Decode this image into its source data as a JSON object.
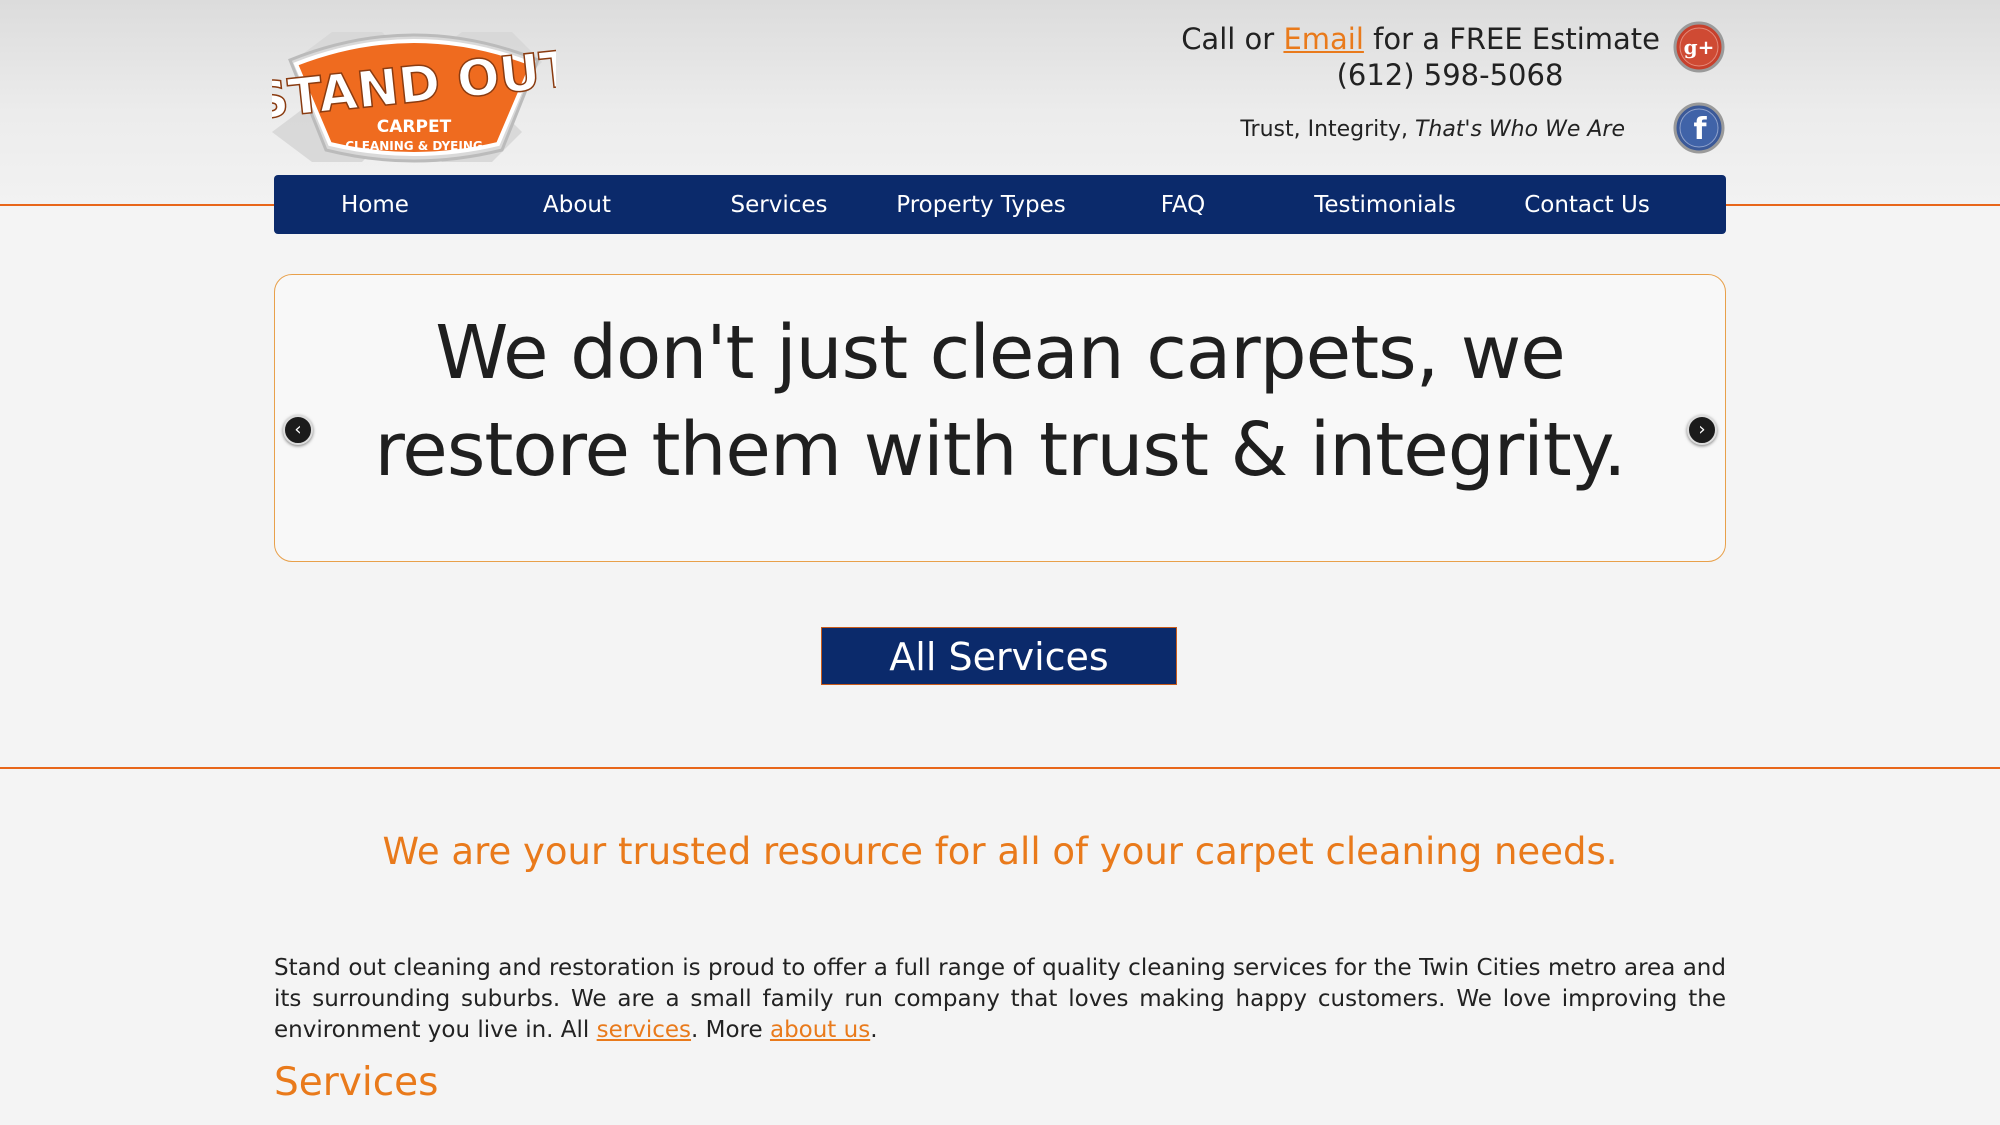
{
  "brand": {
    "logo_line1": "STAND OUT",
    "logo_line2": "CARPET",
    "logo_line3": "CLEANING & DYEING",
    "accent": "#e97a1b",
    "navy": "#0b2a6b"
  },
  "header": {
    "contact_prefix": "Call or",
    "contact_link": "Email",
    "contact_suffix": "for a FREE Estimate",
    "phone": "(612) 598-5068",
    "tagline_plain": "Trust, Integrity,",
    "tagline_italic": "That's Who We Are",
    "social": [
      {
        "icon": "google-plus-icon",
        "label": "g+"
      },
      {
        "icon": "facebook-icon",
        "label": "f"
      }
    ]
  },
  "nav": {
    "items": [
      "Home",
      "About",
      "Services",
      "Property Types",
      "FAQ",
      "Testimonials",
      "Contact Us"
    ]
  },
  "slider": {
    "text": "We don't just clean carpets, we restore them with trust & integrity.",
    "prev_icon": "chevron-left-icon",
    "next_icon": "chevron-right-icon"
  },
  "all_services_button": "All Services",
  "main": {
    "headline": "We are your trusted resource for all of your carpet cleaning needs.",
    "paragraph": "Stand out cleaning and restoration is proud to offer a full range of quality cleaning services for the Twin Cities metro area and its surrounding suburbs. We are a small family run company that loves making happy customers. We love improving the environment you live in. All",
    "link_services": "services",
    "middle": ". More",
    "link_about": "about us",
    "end": ".",
    "services_heading": "Services"
  }
}
